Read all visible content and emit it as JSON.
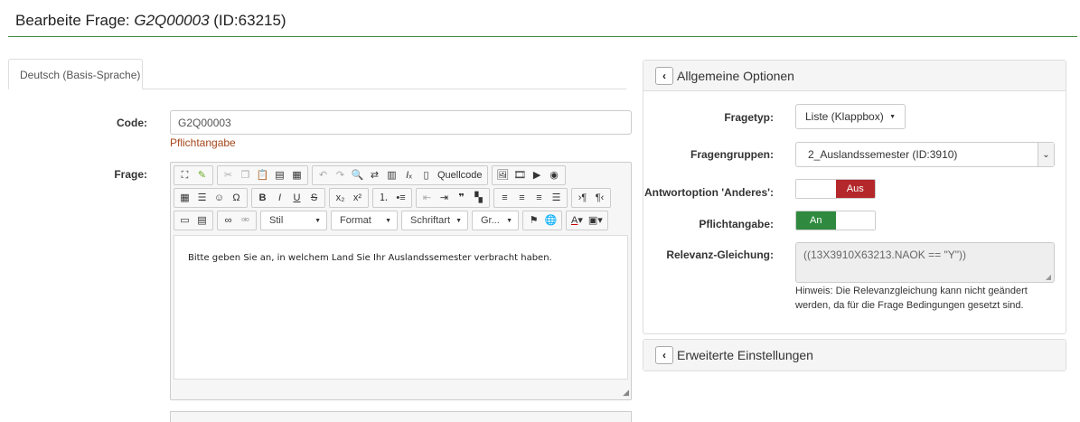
{
  "header": {
    "title_prefix": "Bearbeite Frage: ",
    "question_code": "G2Q00003",
    "title_suffix": " (ID:63215)"
  },
  "tabs": [
    {
      "label": "Deutsch (Basis-Sprache)"
    }
  ],
  "form": {
    "code_label": "Code:",
    "code_value": "G2Q00003",
    "code_note": "Pflichtangabe",
    "question_label": "Frage:",
    "question_text": "Bitte geben Sie an, in welchem Land Sie Ihr Auslandssemester verbracht haben."
  },
  "editor": {
    "source_label": "Quellcode",
    "combos": {
      "style": "Stil",
      "format": "Format",
      "font": "Schriftart",
      "size": "Gr..."
    }
  },
  "general_options": {
    "title": "Allgemeine Optionen",
    "question_type_label": "Fragetyp:",
    "question_type_value": "Liste (Klappbox)",
    "question_group_label": "Fragengruppen:",
    "question_group_value": "2_Auslandssemester (ID:3910)",
    "other_label": "Antwortoption 'Anderes':",
    "other_value": "Aus",
    "mandatory_label": "Pflichtangabe:",
    "mandatory_value": "An",
    "relevance_label": "Relevanz-Gleichung:",
    "relevance_value": "((13X3910X63213.NAOK == \"Y\"))",
    "relevance_hint": "Hinweis: Die Relevanzgleichung kann nicht geändert werden, da für die Frage Bedingungen gesetzt sind."
  },
  "advanced_settings": {
    "title": "Erweiterte Einstellungen"
  },
  "colors": {
    "accent_green": "#2f8a3f",
    "toggle_off_red": "#b4272a",
    "note_orange": "#a6471b"
  }
}
